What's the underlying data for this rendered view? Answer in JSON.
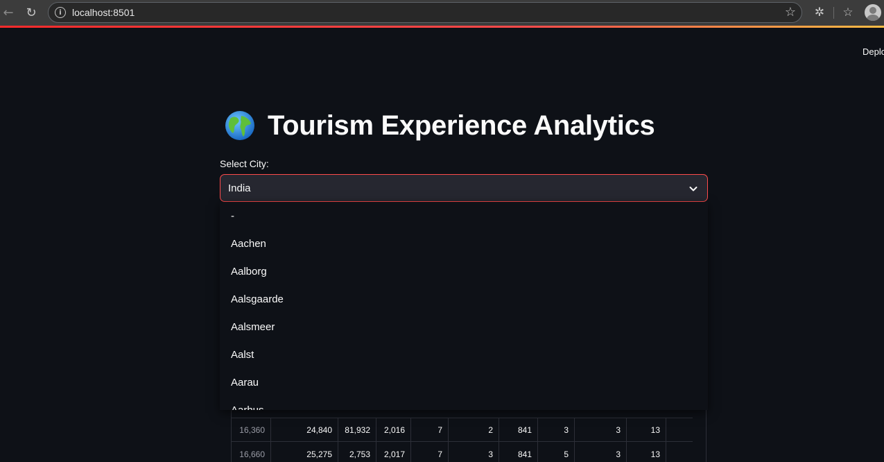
{
  "browser": {
    "url": "localhost:8501"
  },
  "header": {
    "deploy_label": "Deploy"
  },
  "page": {
    "title": "Tourism Experience Analytics",
    "title_icon": "globe-icon"
  },
  "city_select": {
    "label": "Select City:",
    "value": "India",
    "options": [
      "-",
      "Aachen",
      "Aalborg",
      "Aalsgaarde",
      "Aalsmeer",
      "Aalst",
      "Aarau",
      "Aarhus"
    ]
  },
  "table": {
    "rows": [
      [
        "16,360",
        "24,840",
        "81,932",
        "2,016",
        "7",
        "2",
        "841",
        "3",
        "3",
        "13"
      ],
      [
        "16,660",
        "25,275",
        "2,753",
        "2,017",
        "7",
        "3",
        "841",
        "5",
        "3",
        "13"
      ]
    ]
  },
  "colors": {
    "background": "#0e1117",
    "accent": "#ff4b4b",
    "input_bg": "#262730"
  }
}
